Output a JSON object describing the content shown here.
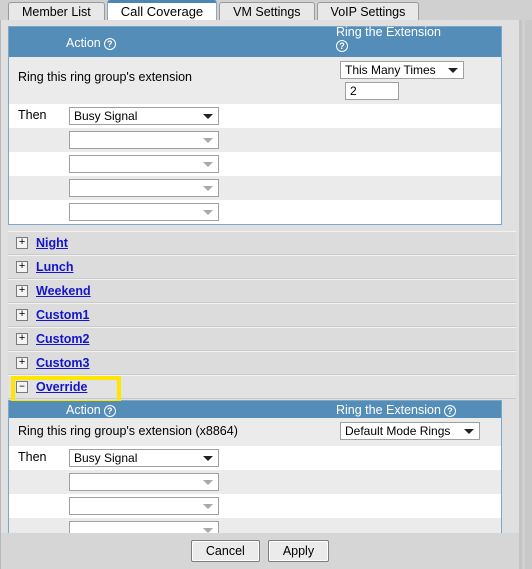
{
  "tabs": [
    {
      "label": "Member List",
      "active": false
    },
    {
      "label": "Call Coverage",
      "active": true
    },
    {
      "label": "VM Settings",
      "active": false
    },
    {
      "label": "VoIP Settings",
      "active": false
    }
  ],
  "colors": {
    "header_blue": "#548db8",
    "link_blue": "#1414cc",
    "highlight_yellow": "#ffe600",
    "panel_gray": "#e0e0e0",
    "row_gray": "#ebebeb"
  },
  "default_section": {
    "header": {
      "action_label": "Action",
      "action_help_icon": "question-mark-icon",
      "ring_label": "Ring the Extension",
      "ring_help_icon": "question-mark-icon"
    },
    "ring_text": "Ring this ring group's extension",
    "ring_mode_select": "This Many Times",
    "ring_count_value": "2",
    "then_label": "Then",
    "then_select": "Busy Signal",
    "empty_selects": [
      "",
      "",
      "",
      ""
    ]
  },
  "accordion": [
    {
      "label": "Night",
      "toggle": "+",
      "expanded": false,
      "highlighted": false
    },
    {
      "label": "Lunch",
      "toggle": "+",
      "expanded": false,
      "highlighted": false
    },
    {
      "label": "Weekend",
      "toggle": "+",
      "expanded": false,
      "highlighted": false
    },
    {
      "label": "Custom1",
      "toggle": "+",
      "expanded": false,
      "highlighted": false
    },
    {
      "label": "Custom2",
      "toggle": "+",
      "expanded": false,
      "highlighted": false
    },
    {
      "label": "Custom3",
      "toggle": "+",
      "expanded": false,
      "highlighted": false
    },
    {
      "label": "Override",
      "toggle": "–",
      "expanded": true,
      "highlighted": true
    }
  ],
  "override_section": {
    "header": {
      "action_label": "Action",
      "action_help_icon": "question-mark-icon",
      "ring_label": "Ring the Extension",
      "ring_help_icon": "question-mark-icon"
    },
    "ring_text": "Ring this ring group's extension (x8864)",
    "ring_mode_select": "Default Mode Rings",
    "then_label": "Then",
    "then_select": "Busy Signal",
    "empty_selects": [
      "",
      "",
      "",
      ""
    ]
  },
  "footer": {
    "cancel_label": "Cancel",
    "apply_label": "Apply"
  }
}
